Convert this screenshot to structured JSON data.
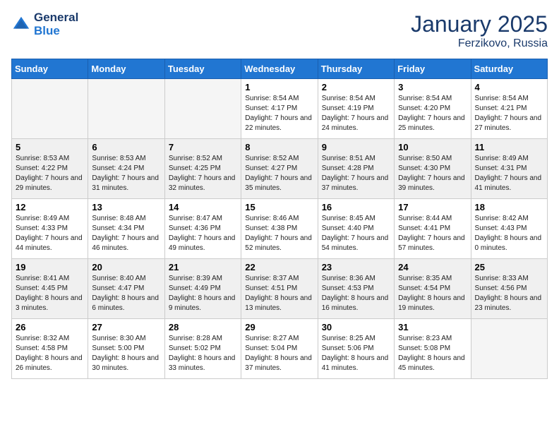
{
  "logo": {
    "line1": "General",
    "line2": "Blue"
  },
  "title": "January 2025",
  "location": "Ferzikovo, Russia",
  "days_of_week": [
    "Sunday",
    "Monday",
    "Tuesday",
    "Wednesday",
    "Thursday",
    "Friday",
    "Saturday"
  ],
  "weeks": [
    [
      {
        "num": "",
        "empty": true
      },
      {
        "num": "",
        "empty": true
      },
      {
        "num": "",
        "empty": true
      },
      {
        "num": "1",
        "sunrise": "Sunrise: 8:54 AM",
        "sunset": "Sunset: 4:17 PM",
        "daylight": "Daylight: 7 hours and 22 minutes."
      },
      {
        "num": "2",
        "sunrise": "Sunrise: 8:54 AM",
        "sunset": "Sunset: 4:19 PM",
        "daylight": "Daylight: 7 hours and 24 minutes."
      },
      {
        "num": "3",
        "sunrise": "Sunrise: 8:54 AM",
        "sunset": "Sunset: 4:20 PM",
        "daylight": "Daylight: 7 hours and 25 minutes."
      },
      {
        "num": "4",
        "sunrise": "Sunrise: 8:54 AM",
        "sunset": "Sunset: 4:21 PM",
        "daylight": "Daylight: 7 hours and 27 minutes."
      }
    ],
    [
      {
        "num": "5",
        "sunrise": "Sunrise: 8:53 AM",
        "sunset": "Sunset: 4:22 PM",
        "daylight": "Daylight: 7 hours and 29 minutes."
      },
      {
        "num": "6",
        "sunrise": "Sunrise: 8:53 AM",
        "sunset": "Sunset: 4:24 PM",
        "daylight": "Daylight: 7 hours and 31 minutes."
      },
      {
        "num": "7",
        "sunrise": "Sunrise: 8:52 AM",
        "sunset": "Sunset: 4:25 PM",
        "daylight": "Daylight: 7 hours and 32 minutes."
      },
      {
        "num": "8",
        "sunrise": "Sunrise: 8:52 AM",
        "sunset": "Sunset: 4:27 PM",
        "daylight": "Daylight: 7 hours and 35 minutes."
      },
      {
        "num": "9",
        "sunrise": "Sunrise: 8:51 AM",
        "sunset": "Sunset: 4:28 PM",
        "daylight": "Daylight: 7 hours and 37 minutes."
      },
      {
        "num": "10",
        "sunrise": "Sunrise: 8:50 AM",
        "sunset": "Sunset: 4:30 PM",
        "daylight": "Daylight: 7 hours and 39 minutes."
      },
      {
        "num": "11",
        "sunrise": "Sunrise: 8:49 AM",
        "sunset": "Sunset: 4:31 PM",
        "daylight": "Daylight: 7 hours and 41 minutes."
      }
    ],
    [
      {
        "num": "12",
        "sunrise": "Sunrise: 8:49 AM",
        "sunset": "Sunset: 4:33 PM",
        "daylight": "Daylight: 7 hours and 44 minutes."
      },
      {
        "num": "13",
        "sunrise": "Sunrise: 8:48 AM",
        "sunset": "Sunset: 4:34 PM",
        "daylight": "Daylight: 7 hours and 46 minutes."
      },
      {
        "num": "14",
        "sunrise": "Sunrise: 8:47 AM",
        "sunset": "Sunset: 4:36 PM",
        "daylight": "Daylight: 7 hours and 49 minutes."
      },
      {
        "num": "15",
        "sunrise": "Sunrise: 8:46 AM",
        "sunset": "Sunset: 4:38 PM",
        "daylight": "Daylight: 7 hours and 52 minutes."
      },
      {
        "num": "16",
        "sunrise": "Sunrise: 8:45 AM",
        "sunset": "Sunset: 4:40 PM",
        "daylight": "Daylight: 7 hours and 54 minutes."
      },
      {
        "num": "17",
        "sunrise": "Sunrise: 8:44 AM",
        "sunset": "Sunset: 4:41 PM",
        "daylight": "Daylight: 7 hours and 57 minutes."
      },
      {
        "num": "18",
        "sunrise": "Sunrise: 8:42 AM",
        "sunset": "Sunset: 4:43 PM",
        "daylight": "Daylight: 8 hours and 0 minutes."
      }
    ],
    [
      {
        "num": "19",
        "sunrise": "Sunrise: 8:41 AM",
        "sunset": "Sunset: 4:45 PM",
        "daylight": "Daylight: 8 hours and 3 minutes."
      },
      {
        "num": "20",
        "sunrise": "Sunrise: 8:40 AM",
        "sunset": "Sunset: 4:47 PM",
        "daylight": "Daylight: 8 hours and 6 minutes."
      },
      {
        "num": "21",
        "sunrise": "Sunrise: 8:39 AM",
        "sunset": "Sunset: 4:49 PM",
        "daylight": "Daylight: 8 hours and 9 minutes."
      },
      {
        "num": "22",
        "sunrise": "Sunrise: 8:37 AM",
        "sunset": "Sunset: 4:51 PM",
        "daylight": "Daylight: 8 hours and 13 minutes."
      },
      {
        "num": "23",
        "sunrise": "Sunrise: 8:36 AM",
        "sunset": "Sunset: 4:53 PM",
        "daylight": "Daylight: 8 hours and 16 minutes."
      },
      {
        "num": "24",
        "sunrise": "Sunrise: 8:35 AM",
        "sunset": "Sunset: 4:54 PM",
        "daylight": "Daylight: 8 hours and 19 minutes."
      },
      {
        "num": "25",
        "sunrise": "Sunrise: 8:33 AM",
        "sunset": "Sunset: 4:56 PM",
        "daylight": "Daylight: 8 hours and 23 minutes."
      }
    ],
    [
      {
        "num": "26",
        "sunrise": "Sunrise: 8:32 AM",
        "sunset": "Sunset: 4:58 PM",
        "daylight": "Daylight: 8 hours and 26 minutes."
      },
      {
        "num": "27",
        "sunrise": "Sunrise: 8:30 AM",
        "sunset": "Sunset: 5:00 PM",
        "daylight": "Daylight: 8 hours and 30 minutes."
      },
      {
        "num": "28",
        "sunrise": "Sunrise: 8:28 AM",
        "sunset": "Sunset: 5:02 PM",
        "daylight": "Daylight: 8 hours and 33 minutes."
      },
      {
        "num": "29",
        "sunrise": "Sunrise: 8:27 AM",
        "sunset": "Sunset: 5:04 PM",
        "daylight": "Daylight: 8 hours and 37 minutes."
      },
      {
        "num": "30",
        "sunrise": "Sunrise: 8:25 AM",
        "sunset": "Sunset: 5:06 PM",
        "daylight": "Daylight: 8 hours and 41 minutes."
      },
      {
        "num": "31",
        "sunrise": "Sunrise: 8:23 AM",
        "sunset": "Sunset: 5:08 PM",
        "daylight": "Daylight: 8 hours and 45 minutes."
      },
      {
        "num": "",
        "empty": true
      }
    ]
  ]
}
